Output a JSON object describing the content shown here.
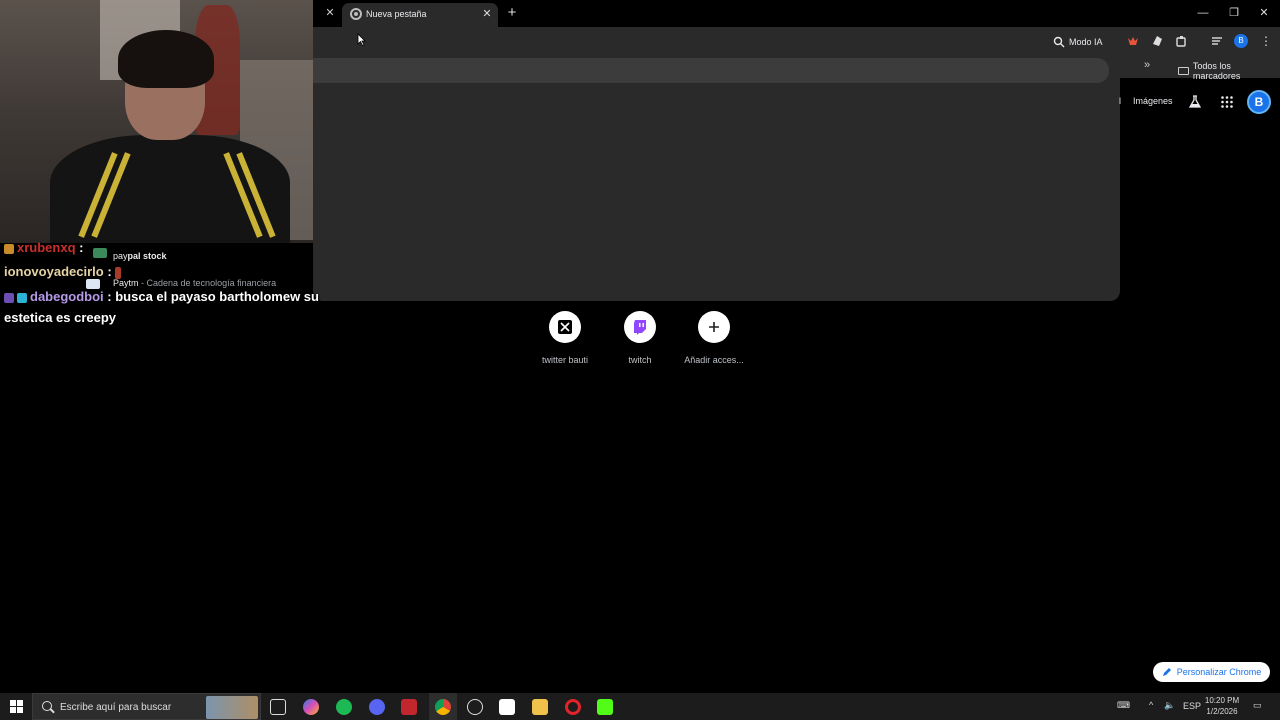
{
  "browser": {
    "tab_title": "Nueva pestaña",
    "modo_ia": "Modo IA",
    "bookmarks_overflow": "»",
    "all_bookmarks": "Todos los marcadores",
    "profile_initial": "B"
  },
  "page": {
    "gmail_partial": "l",
    "images_link": "Imágenes",
    "account_initial": "B",
    "shortcuts": [
      {
        "label": "twitter bauti",
        "icon": "x-logo-icon"
      },
      {
        "label": "twitch",
        "icon": "twitch-logo-icon"
      },
      {
        "label": "Añadir acces...",
        "icon": "plus-icon"
      }
    ],
    "customize_button": "Personalizar Chrome"
  },
  "suggestions": [
    {
      "prefix": "pay",
      "bold": "pal stock",
      "sub": ""
    },
    {
      "prefix": "Paytm",
      "bold": "",
      "sub": " - Cadena de tecnología financiera"
    }
  ],
  "chat": [
    {
      "user": "xrubenxq",
      "message": ""
    },
    {
      "user": "ionovoyadecirlo",
      "message": ""
    },
    {
      "user": "dabegodboi",
      "message": "busca el payaso bartholomew su"
    },
    {
      "user": "",
      "message": "estetica es creepy"
    }
  ],
  "taskbar": {
    "search_placeholder": "Escribe aquí para buscar",
    "language": "ESP",
    "time": "10:20 PM",
    "date": "1/2/2026"
  },
  "colors": {
    "chrome_dark": "#2a2a2b",
    "accent_blue": "#1a73e8",
    "twitch_purple": "#9146ff"
  }
}
